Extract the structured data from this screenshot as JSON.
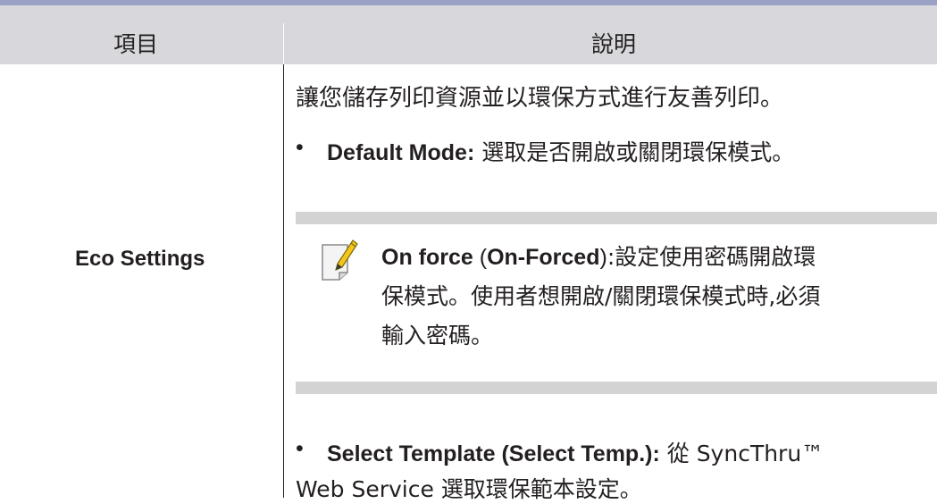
{
  "table": {
    "header": {
      "item": "項目",
      "description": "說明"
    },
    "row": {
      "label": "Eco Settings",
      "intro": "讓您儲存列印資源並以環保方式進行友善列印。",
      "bullets": [
        {
          "marker": "•",
          "bold": "Default Mode:",
          "text": " 選取是否開啟或關閉環保模式。"
        },
        {
          "marker": "•",
          "bold": "Select Template (Select Temp.):",
          "text": " 從 SyncThru™",
          "continuation": "Web Service 選取環保範本設定。"
        }
      ],
      "note": {
        "icon": "note-pencil-icon",
        "bold_a": "On force",
        "paren_open": " (",
        "bold_b": "On-Forced",
        "paren_close": ")",
        "line1_rest": ":設定使用密碼開啟環",
        "line2": "保模式。使用者想開啟/關閉環保模式時,必須",
        "line3": "輸入密碼。"
      }
    }
  },
  "colors": {
    "top_rule": "#9aa1c6",
    "header_bg": "#d8d8dc",
    "note_band": "#d3d3d3",
    "text": "#231f20"
  }
}
